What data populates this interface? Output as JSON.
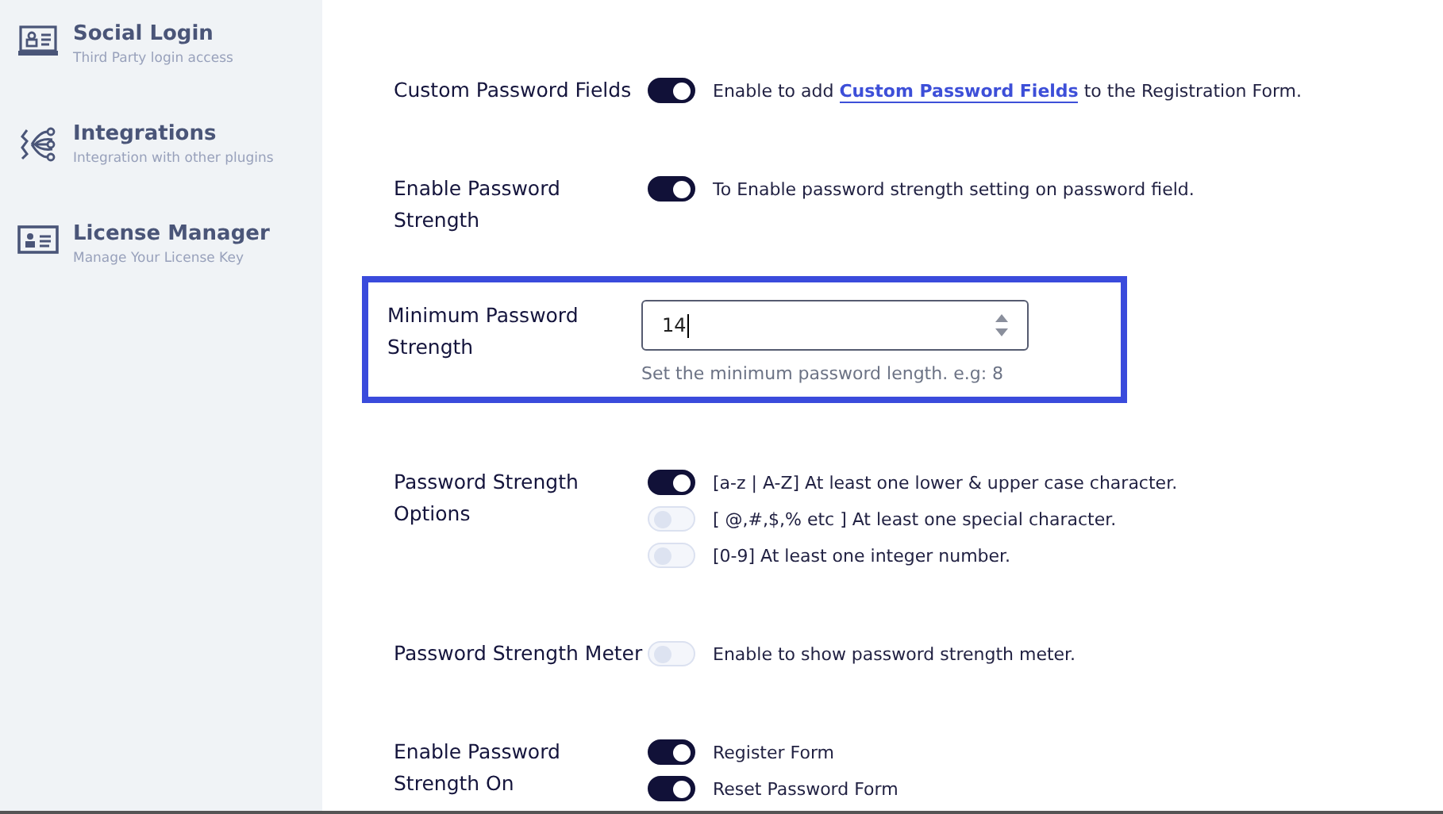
{
  "sidebar": {
    "items": [
      {
        "kind": "social",
        "title": "Social Login",
        "subtitle": "Third Party login access"
      },
      {
        "kind": "integrations",
        "title": "Integrations",
        "subtitle": "Integration with other plugins"
      },
      {
        "kind": "license",
        "title": "License Manager",
        "subtitle": "Manage Your License Key"
      }
    ]
  },
  "settings": [
    {
      "kind": "toggle",
      "label": "Custom Password Fields",
      "on": true,
      "description": {
        "before": "Enable to add",
        "link": "Custom Password Fields",
        "after": "to the Registration Form."
      }
    },
    {
      "kind": "toggle",
      "label": "Enable Password Strength",
      "on": true,
      "description": {
        "before": "To Enable password strength setting on password field."
      }
    },
    {
      "kind": "number",
      "label": "Minimum Password Strength",
      "value": "14",
      "help": "Set the minimum password length. e.g: 8",
      "highlighted": true
    },
    {
      "kind": "options",
      "label": "Password Strength Options",
      "options": [
        {
          "on": true,
          "text": "[a-z | A-Z] At least one lower & upper case character."
        },
        {
          "on": false,
          "text": "[ @,#,$,% etc ] At least one special character."
        },
        {
          "on": false,
          "text": "[0-9] At least one integer number."
        }
      ]
    },
    {
      "kind": "toggle",
      "label": "Password Strength Meter",
      "on": false,
      "description": {
        "before": "Enable to show password strength meter."
      }
    },
    {
      "kind": "options",
      "label": "Enable Password Strength On",
      "options": [
        {
          "on": true,
          "text": "Register Form"
        },
        {
          "on": true,
          "text": "Reset Password Form"
        }
      ]
    }
  ]
}
